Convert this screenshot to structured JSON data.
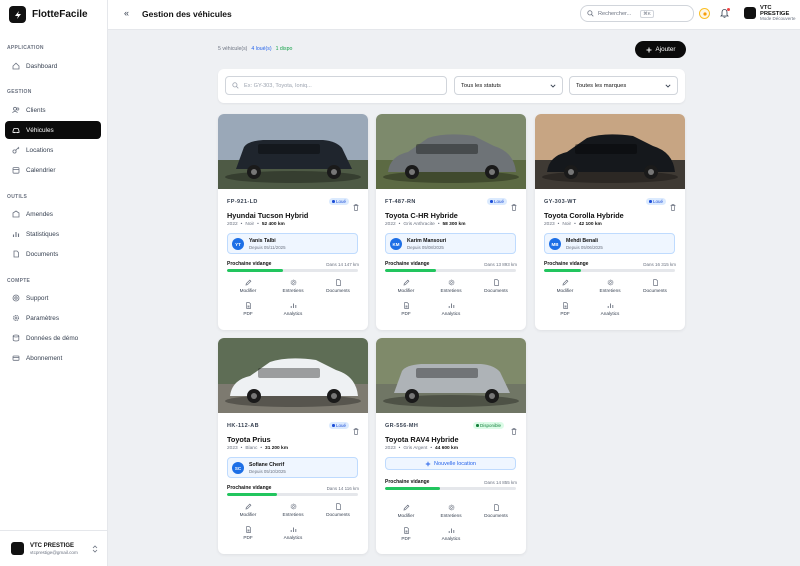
{
  "app": {
    "name": "FlotteFacile"
  },
  "sidebar": {
    "sections": {
      "application": "APPLICATION",
      "gestion": "GESTION",
      "outils": "OUTILS",
      "compte": "COMPTE"
    },
    "items": [
      "Dashboard",
      "Clients",
      "Véhicules",
      "Locations",
      "Calendrier",
      "Amendes",
      "Statistiques",
      "Documents",
      "Support",
      "Paramètres",
      "Données de démo",
      "Abonnement"
    ],
    "active": "Véhicules",
    "footer": {
      "company": "VTC PRESTIGE",
      "email": "vtcprestige@gmail.com"
    }
  },
  "header": {
    "collapse_icon": "«",
    "title": "Gestion des véhicules",
    "search_placeholder": "Rechercher...",
    "search_shortcut": "⌘K",
    "company_name": "VTC PRESTIGE",
    "company_mode": "Mode Découverte"
  },
  "summary": {
    "total": "5 véhicule(s)",
    "rented": "4 loué(s)",
    "available": "1 dispo"
  },
  "add_button": "Ajouter",
  "filters": {
    "search_placeholder": "Ex: GY-303, Toyota, Ioniq...",
    "status": "Tous les statuts",
    "brand": "Toutes les marques"
  },
  "oil_change_label": "Prochaine vidange",
  "new_location_label": "Nouvelle location",
  "actions": {
    "modify": "Modifier",
    "maintenance": "Entretiens",
    "documents": "Documents",
    "pdf": "PDF",
    "analytics": "Analytics"
  },
  "vehicles": [
    {
      "plate": "FP-921-LD",
      "status": "Loué",
      "status_color": "#1d4ed8",
      "model": "Hyundai Tucson Hybrid",
      "year": "2022",
      "color": "Noir",
      "mileage": "52 400 km",
      "driver": {
        "initials": "YT",
        "name": "Yanis Talbi",
        "since": "Depuis 05/11/2025"
      },
      "oil_change": "Dans 14 147 km",
      "oil_progress": 0.43
    },
    {
      "plate": "FT-487-RN",
      "status": "Loué",
      "status_color": "#1d4ed8",
      "model": "Toyota C-HR Hybride",
      "year": "2022",
      "color": "Gris Anthracite",
      "mileage": "58 300 km",
      "driver": {
        "initials": "KM",
        "name": "Karim Mansouri",
        "since": "Depuis 05/08/2025"
      },
      "oil_change": "Dans 13 893 km",
      "oil_progress": 0.39
    },
    {
      "plate": "GY-303-WT",
      "status": "Loué",
      "status_color": "#1d4ed8",
      "model": "Toyota Corolla Hybride",
      "year": "2023",
      "color": "Noir",
      "mileage": "42 100 km",
      "driver": {
        "initials": "MB",
        "name": "Mehdi Benali",
        "since": "Depuis 05/06/2025"
      },
      "oil_change": "Dans 16 315 km",
      "oil_progress": 0.28
    },
    {
      "plate": "HK-112-AB",
      "status": "Loué",
      "status_color": "#1d4ed8",
      "model": "Toyota Prius",
      "year": "2023",
      "color": "Blanc",
      "mileage": "31 200 km",
      "driver": {
        "initials": "SC",
        "name": "Sofiane Cherif",
        "since": "Depuis 05/10/2025"
      },
      "oil_change": "Dans 14 116 km",
      "oil_progress": 0.38
    },
    {
      "plate": "GR-556-MH",
      "status": "Disponible",
      "status_color": "#15803d",
      "model": "Toyota RAV4 Hybride",
      "year": "2023",
      "color": "Gris Argent",
      "mileage": "44 600 km",
      "driver": null,
      "oil_change": "Dans 14 855 km",
      "oil_progress": 0.42
    }
  ],
  "icons": [
    "flotte-logo-icon",
    "dashboard-icon",
    "clients-icon",
    "vehicle-icon",
    "locations-icon",
    "calendar-icon",
    "fines-icon",
    "stats-icon",
    "documents-icon",
    "support-icon",
    "settings-icon",
    "demo-data-icon",
    "subscription-icon",
    "search-icon",
    "sun-icon",
    "bell-icon",
    "plus-icon",
    "trash-icon",
    "edit-icon",
    "maintenance-icon",
    "pdf-icon",
    "analytics-icon",
    "chevron-down-icon",
    "chevron-updown-icon"
  ]
}
